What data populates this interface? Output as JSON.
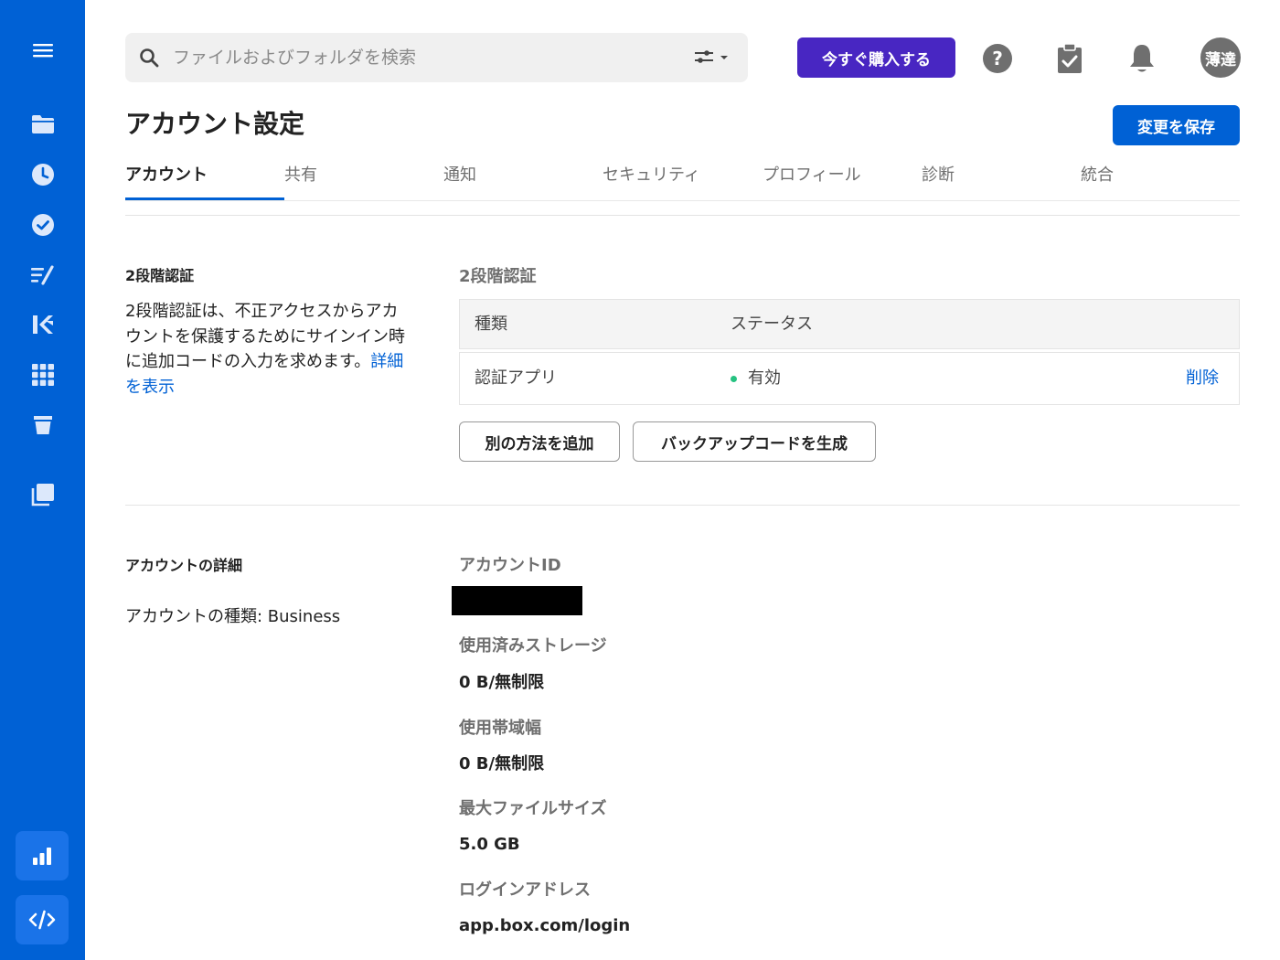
{
  "search": {
    "placeholder": "ファイルおよびフォルダを検索"
  },
  "topbar": {
    "buy_label": "今すぐ購入する",
    "avatar_initials": "薄達"
  },
  "sidebar": {
    "icons": [
      "menu-icon",
      "folder-icon",
      "clock-icon",
      "check-circle-icon",
      "notes-icon",
      "relay-icon",
      "apps-grid-icon",
      "trash-icon",
      "collections-icon",
      "analytics-icon",
      "developer-code-icon"
    ]
  },
  "header": {
    "title": "アカウント設定",
    "save_label": "変更を保存"
  },
  "tabs": [
    "アカウント",
    "共有",
    "通知",
    "セキュリティ",
    "プロフィール",
    "診断",
    "統合"
  ],
  "two_factor": {
    "section_title": "2段階認証",
    "description": "2段階認証は、不正アクセスからアカウントを保護するためにサインイン時に追加コードの入力を求めます。",
    "details_link": "詳細を表示",
    "panel_title": "2段階認証",
    "table": {
      "headers": [
        "種類",
        "ステータス"
      ],
      "rows": [
        {
          "type": "認証アプリ",
          "status": "有効",
          "action": "削除"
        }
      ]
    },
    "add_method_label": "別の方法を追加",
    "backup_codes_label": "バックアップコードを生成"
  },
  "account_details": {
    "section_title": "アカウントの詳細",
    "account_type": "アカウントの種類: Business",
    "account_id_label": "アカウントID",
    "storage_label": "使用済みストレージ",
    "storage_value": "0 B/無制限",
    "bandwidth_label": "使用帯域幅",
    "bandwidth_value": "0 B/無制限",
    "max_file_label": "最大ファイルサイズ",
    "max_file_value": "5.0 GB",
    "login_label": "ログインアドレス",
    "login_value": "app.box.com/login"
  },
  "colors": {
    "sidebar": "#0061d5",
    "buy_button": "#4826c2",
    "primary": "#0061d5",
    "status_green": "#26c281"
  }
}
